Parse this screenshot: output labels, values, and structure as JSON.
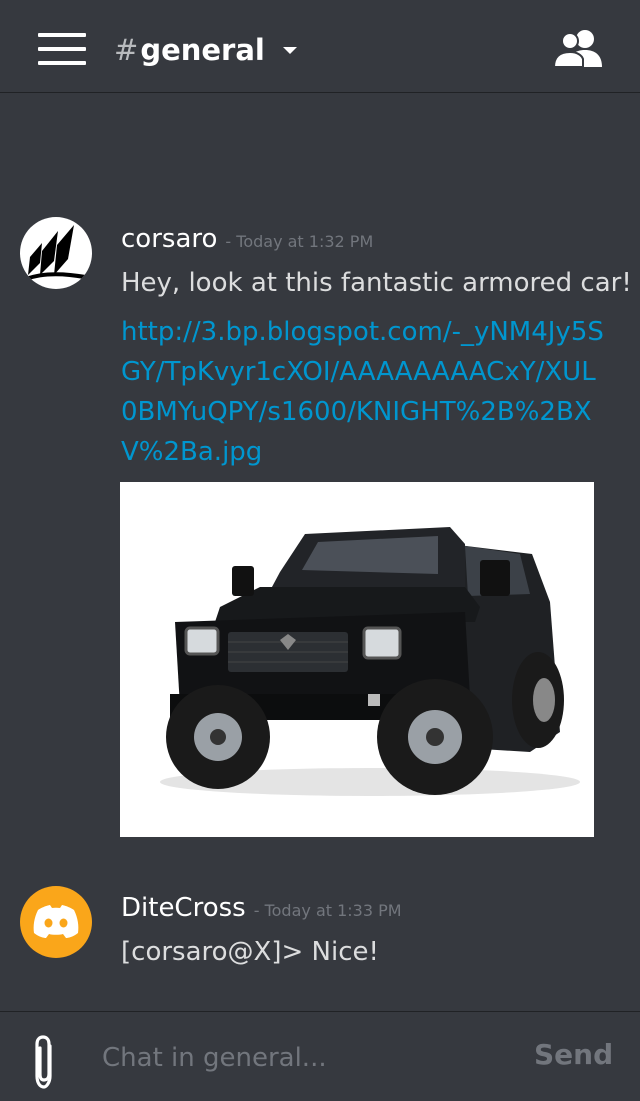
{
  "header": {
    "hash": "#",
    "channel_name": "general",
    "menu_icon": "hamburger-menu-icon",
    "members_icon": "members-icon"
  },
  "messages": [
    {
      "author": "corsaro",
      "timestamp": "- Today at 1:32 PM",
      "text": "Hey, look at this fantastic armored car!",
      "link": "http://3.bp.blogspot.com/-_yNM4Jy5SGY/TpKvyr1cXOI/AAAAAAAACxY/XUL0BMYuQPY/s1600/KNIGHT%2B%2BXV%2Ba.jpg",
      "avatar": "corsair-sails-logo"
    },
    {
      "author": "DiteCross",
      "timestamp": "- Today at 1:33 PM",
      "text": "[corsaro@X]> Nice!",
      "avatar": "discord-logo"
    }
  ],
  "composer": {
    "placeholder": "Chat in general...",
    "send_label": "Send",
    "attach_icon": "paperclip-icon"
  },
  "colors": {
    "background": "#36393f",
    "link": "#0096cf",
    "muted": "#72767d",
    "discord_orange": "#faa61a"
  }
}
